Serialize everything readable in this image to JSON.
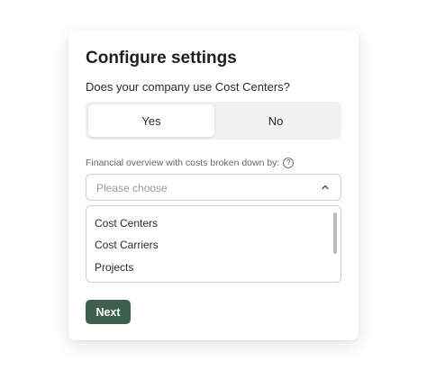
{
  "title": "Configure settings",
  "question": "Does your company use Cost Centers?",
  "toggle": {
    "yes_label": "Yes",
    "no_label": "No",
    "selected": "Yes"
  },
  "field": {
    "label": "Financial overview with costs broken down by:",
    "help_icon": "?",
    "placeholder": "Please choose",
    "options": [
      "Cost Centers",
      "Cost Carriers",
      "Projects"
    ]
  },
  "next_label": "Next",
  "colors": {
    "button": "#3d5f4e",
    "toggle_track": "#f1f1f1"
  }
}
